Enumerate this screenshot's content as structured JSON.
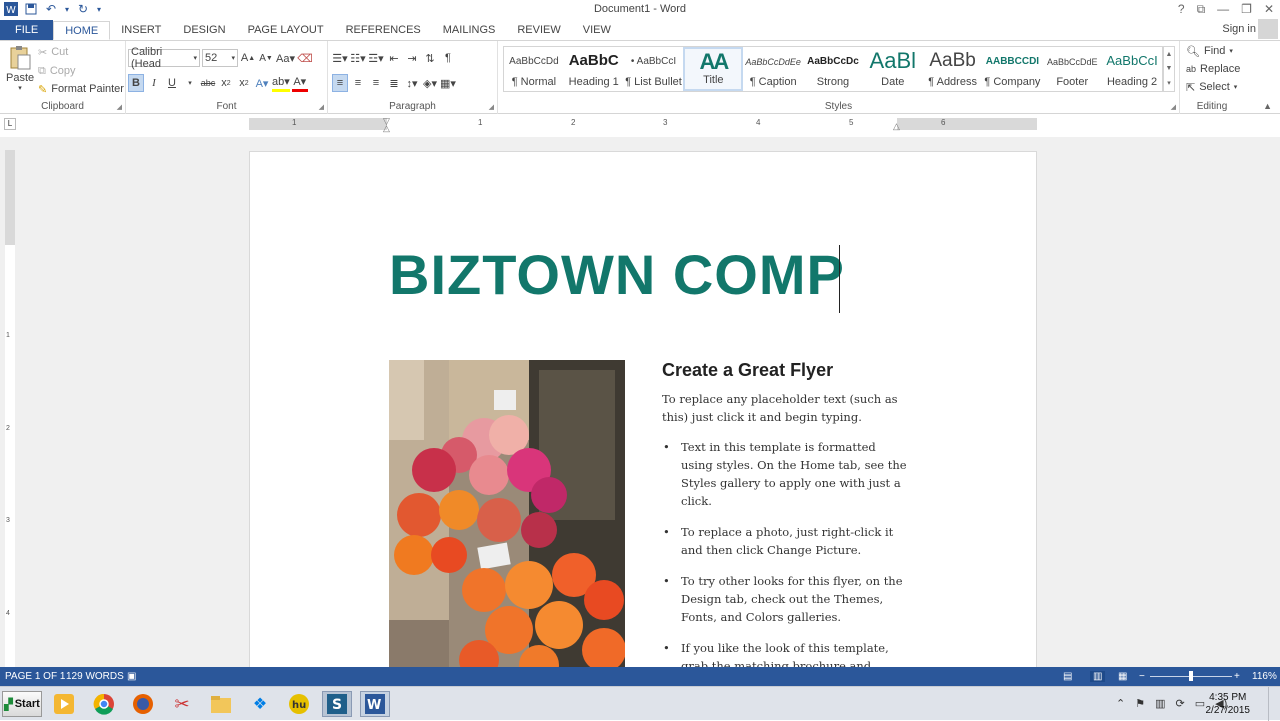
{
  "window": {
    "title": "Document1 - Word",
    "sign_in": "Sign in"
  },
  "tabs": [
    "FILE",
    "HOME",
    "INSERT",
    "DESIGN",
    "PAGE LAYOUT",
    "REFERENCES",
    "MAILINGS",
    "REVIEW",
    "VIEW"
  ],
  "clipboard": {
    "paste": "Paste",
    "cut": "Cut",
    "copy": "Copy",
    "format_painter": "Format Painter",
    "label": "Clipboard"
  },
  "font": {
    "name": "Calibri (Head",
    "size": "52",
    "label": "Font"
  },
  "paragraph": {
    "label": "Paragraph"
  },
  "styles": {
    "label": "Styles",
    "items": [
      {
        "preview": "AaBbCcDd",
        "name": "¶ Normal"
      },
      {
        "preview": "AaBbC",
        "name": "Heading 1"
      },
      {
        "preview": "• AaBbCcI",
        "name": "¶ List Bullet"
      },
      {
        "preview": "AA",
        "name": "Title"
      },
      {
        "preview": "AaBbCcDdEe",
        "name": "¶ Caption"
      },
      {
        "preview": "AaBbCcDc",
        "name": "Strong"
      },
      {
        "preview": "AaBl",
        "name": "Date"
      },
      {
        "preview": "AaBb",
        "name": "¶ Address"
      },
      {
        "preview": "AABBCCDI",
        "name": "¶ Company"
      },
      {
        "preview": "AaBbCcDdE",
        "name": "Footer"
      },
      {
        "preview": "AaBbCcI",
        "name": "Heading 2"
      }
    ]
  },
  "editing": {
    "find": "Find",
    "replace": "Replace",
    "select": "Select",
    "label": "Editing"
  },
  "ruler": {
    "numbers": [
      "1",
      "1",
      "2",
      "3",
      "4",
      "5",
      "6"
    ],
    "vnumbers": [
      "1",
      "2",
      "3",
      "4"
    ],
    "tab_selector": "L"
  },
  "document": {
    "heading": "BIZTOWN COMP",
    "flyer_title": "Create a Great Flyer",
    "intro": "To replace any placeholder text (such as this) just click it and begin typing.",
    "bullets": [
      "Text in this template is formatted using styles. On the Home tab, see the Styles gallery to apply one with just a click.",
      "To replace a photo, just right-click it and then click Change Picture.",
      "To try other looks for this flyer, on the Design tab, check out the Themes, Fonts, and Colors galleries.",
      "If you like the look of this template, grab the matching brochure and postcard templates to get a"
    ]
  },
  "status": {
    "page": "PAGE 1 OF 1",
    "words": "129 WORDS",
    "zoom": "116%"
  },
  "taskbar": {
    "start": "Start",
    "time": "4:35 PM",
    "date": "2/27/2015"
  },
  "colors": {
    "accent": "#2b579a",
    "title_teal": "#12776b"
  }
}
